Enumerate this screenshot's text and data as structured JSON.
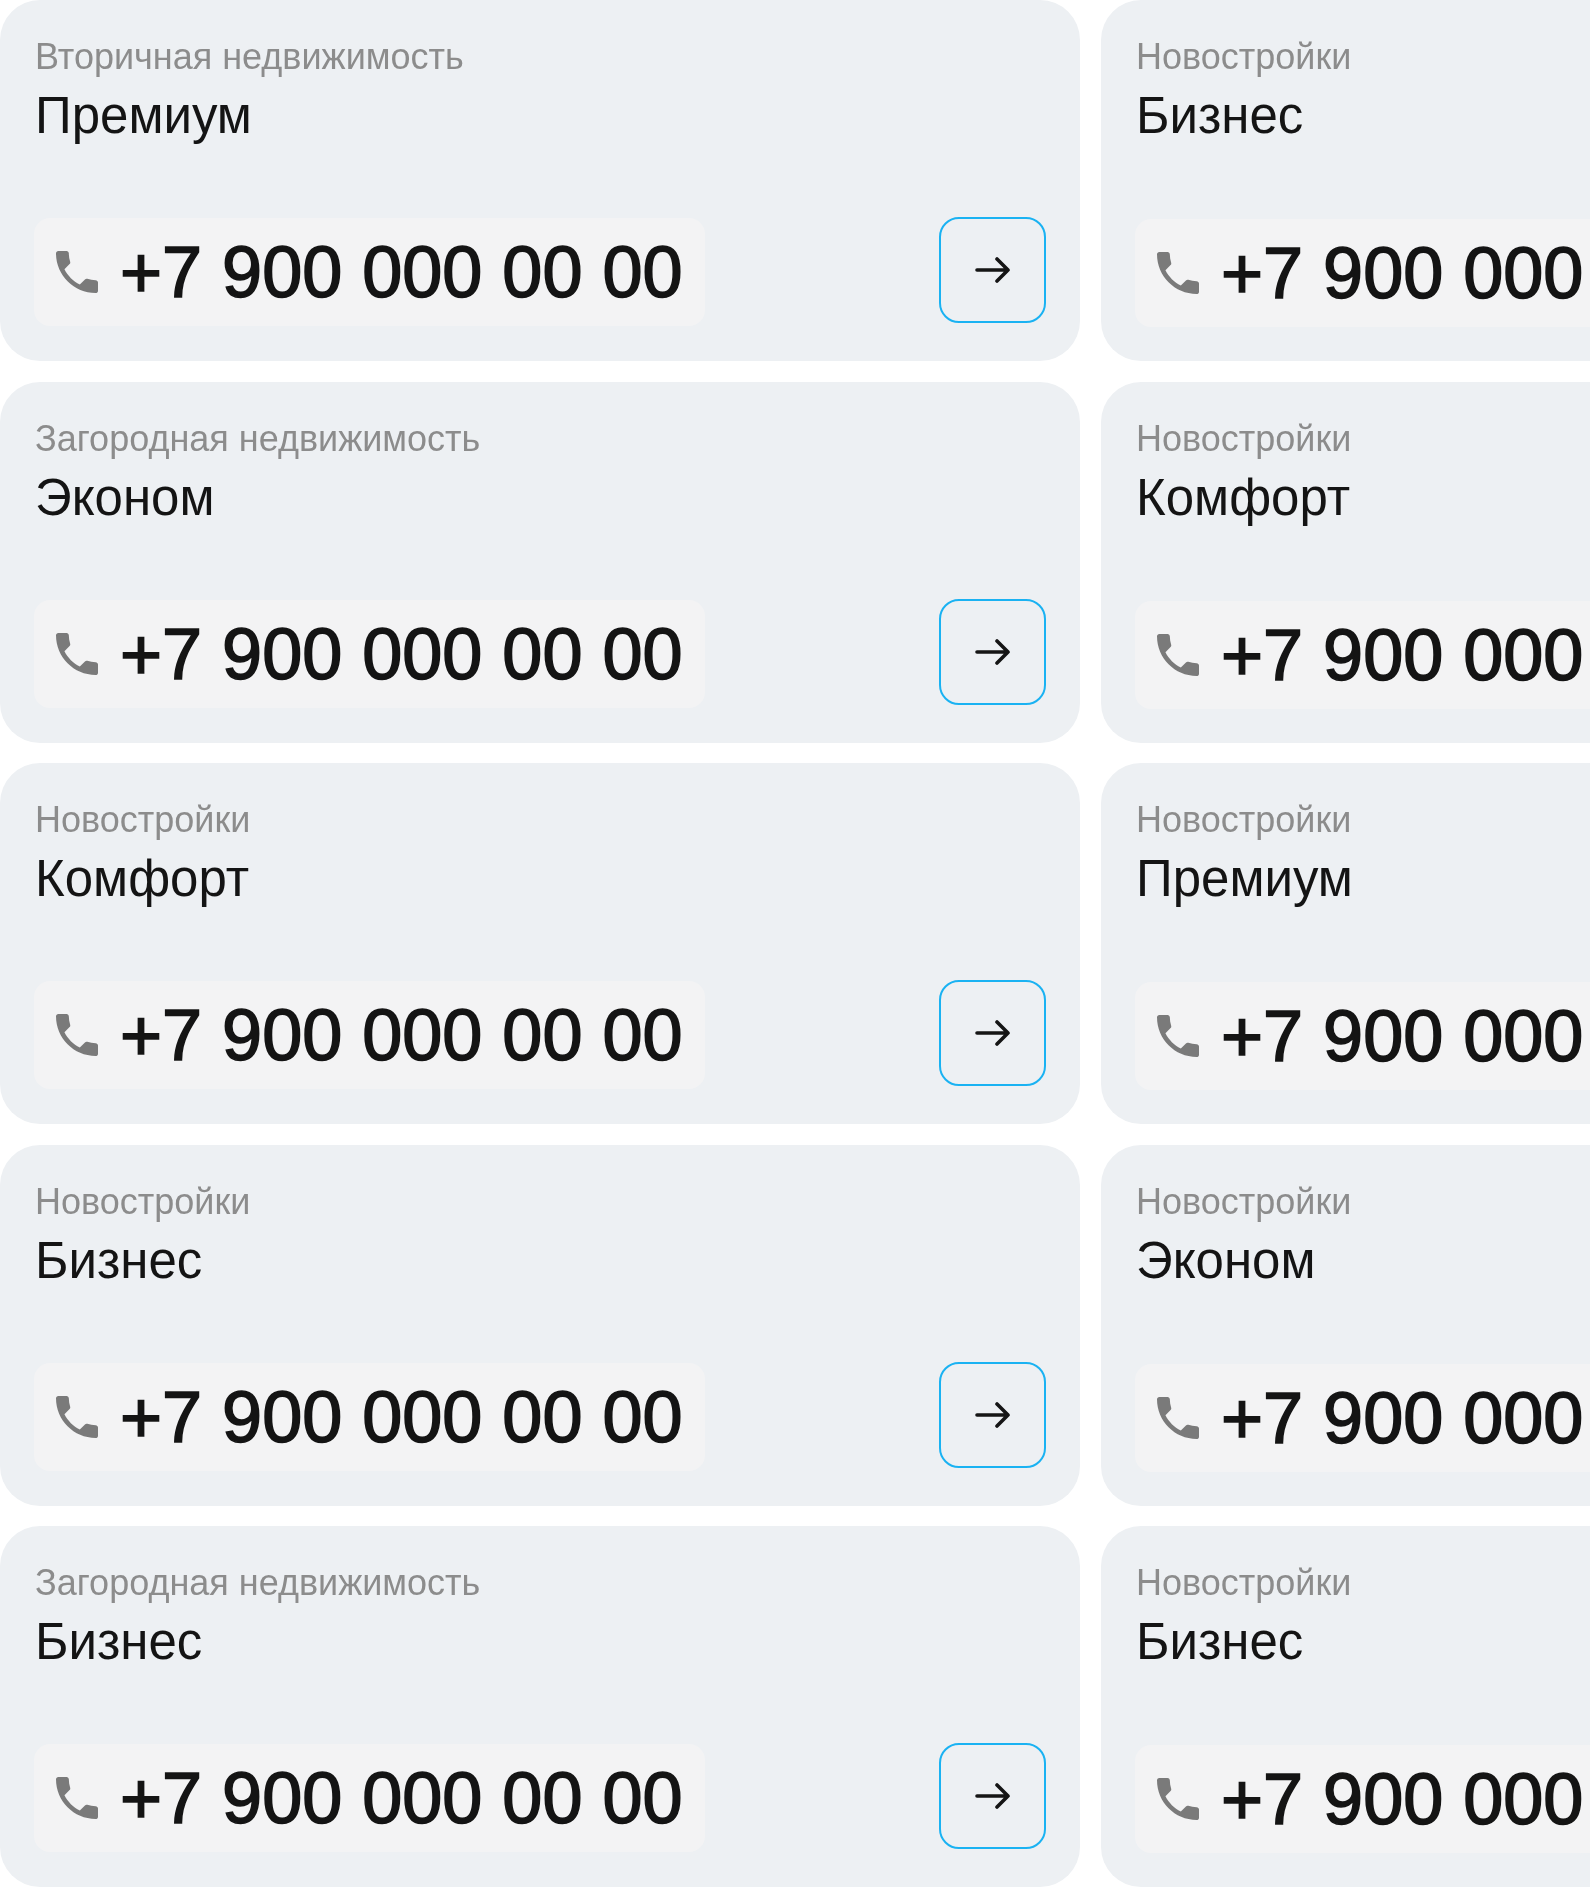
{
  "columns": [
    {
      "cards": [
        {
          "category": "Вторичная недвижимость",
          "title": "Премиум",
          "phone": "+7 900 000 00 00",
          "arrow_button": true
        },
        {
          "category": "Загородная недвижимость",
          "title": "Эконом",
          "phone": "+7 900 000 00 00",
          "arrow_button": true
        },
        {
          "category": "Новостройки",
          "title": "Комфорт",
          "phone": "+7 900 000 00 00",
          "arrow_button": true
        },
        {
          "category": "Новостройки",
          "title": "Бизнес",
          "phone": "+7 900 000 00 00",
          "arrow_button": true
        },
        {
          "category": "Загородная недвижимость",
          "title": "Бизнес",
          "phone": "+7 900 000 00 00",
          "arrow_button": true
        }
      ]
    },
    {
      "cards": [
        {
          "category": "Новостройки",
          "title": "Бизнес",
          "phone": "+7 900 000",
          "arrow_button": false
        },
        {
          "category": "Новостройки",
          "title": "Комфорт",
          "phone": "+7 900 000",
          "arrow_button": false
        },
        {
          "category": "Новостройки",
          "title": "Премиум",
          "phone": "+7 900 000",
          "arrow_button": false
        },
        {
          "category": "Новостройки",
          "title": "Эконом",
          "phone": "+7 900 000",
          "arrow_button": false
        },
        {
          "category": "Новостройки",
          "title": "Бизнес",
          "phone": "+7 900 000",
          "arrow_button": false
        }
      ]
    }
  ]
}
